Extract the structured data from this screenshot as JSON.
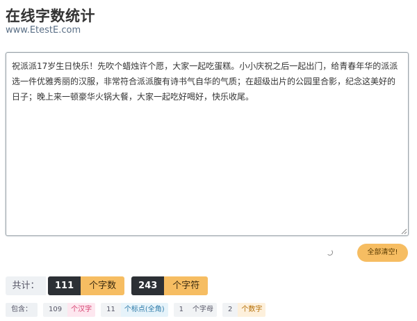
{
  "header": {
    "title": "在线字数统计",
    "subtitle": "www.EtestE.com"
  },
  "editor": {
    "text": "祝派派17岁生日快乐！先吹个蜡烛许个愿，大家一起吃蛋糕。小小庆祝之后一起出门，给青春年华的派派选一件优雅秀丽的汉服，非常符合派派腹有诗书气自华的气质；在超级出片的公园里合影，纪念这美好的日子；晚上来一顿豪华火锅大餐，大家一起吃好喝好，快乐收尾。"
  },
  "actions": {
    "clear_label": "全部清空!"
  },
  "totals": {
    "label": "共计：",
    "chars_value": "111",
    "chars_label": "个字数",
    "symbols_value": "243",
    "symbols_label": "个字符"
  },
  "breakdown": {
    "label": "包含：",
    "items": [
      {
        "value": "109",
        "unit": "个汉字"
      },
      {
        "value": "11",
        "unit": "个标点(全角)"
      },
      {
        "value": "1",
        "unit": "个字母"
      },
      {
        "value": "2",
        "unit": "个数字"
      }
    ]
  },
  "colors": {
    "accent": "#f6bd62",
    "dark": "#2c3035",
    "subtitle": "#5a6f86"
  }
}
